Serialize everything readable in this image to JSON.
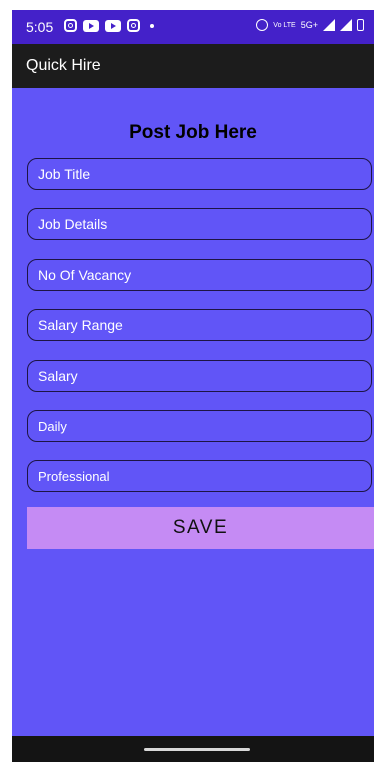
{
  "status_bar": {
    "time": "5:05",
    "network_text": "5G+",
    "lte_text": "Vo LTE"
  },
  "app_bar": {
    "title": "Quick Hire"
  },
  "form": {
    "heading": "Post Job Here",
    "fields": {
      "job_title_placeholder": "Job Title",
      "job_details_placeholder": "Job Details",
      "vacancy_placeholder": "No Of Vacancy",
      "salary_range_placeholder": "Salary Range",
      "salary_placeholder": "Salary",
      "pay_frequency_value": "Daily",
      "job_type_value": "Professional"
    },
    "save_label": "SAVE"
  },
  "colors": {
    "background": "#6155f7",
    "status_bar": "#4421c9",
    "app_bar": "#1c1c1c",
    "save_button": "#c58bf4"
  }
}
